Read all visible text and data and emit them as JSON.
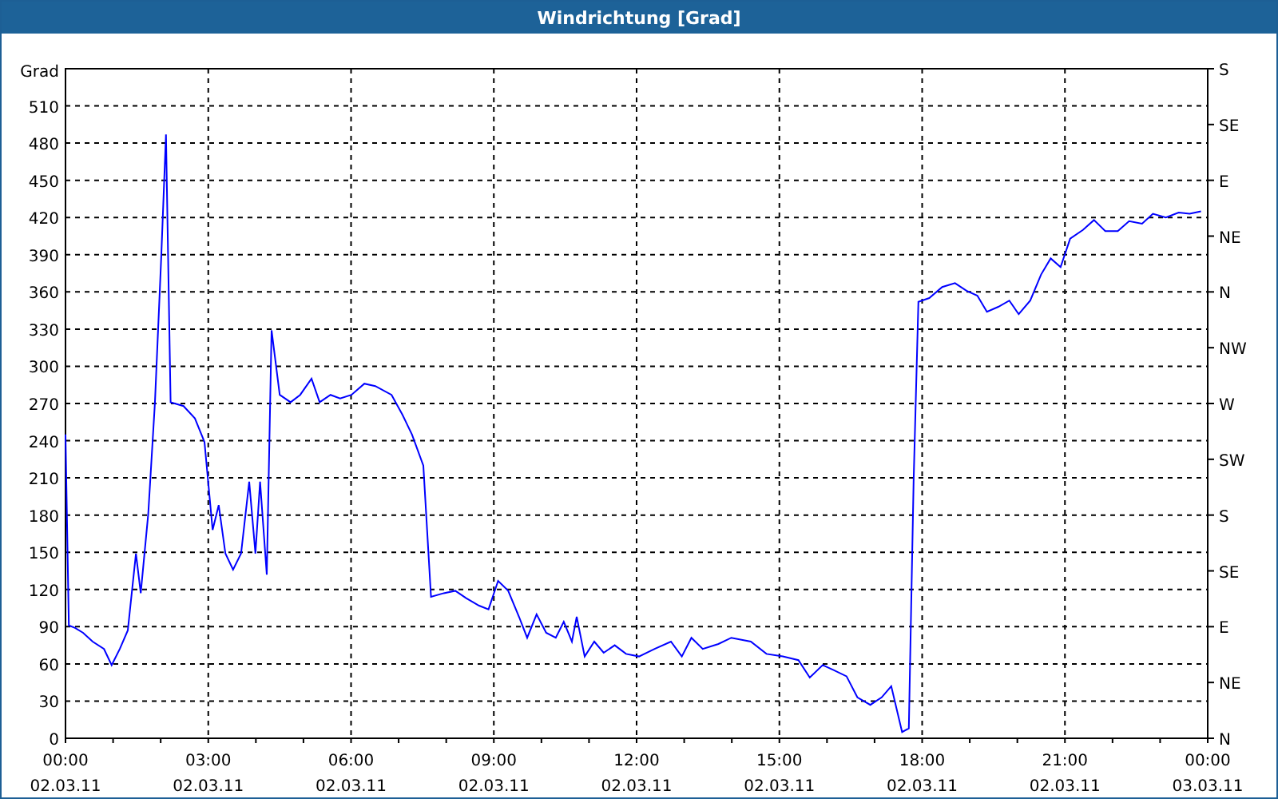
{
  "window": {
    "title": "Windrichtung [Grad]"
  },
  "chart": {
    "x_dates": [
      "02.03.11",
      "02.03.11",
      "02.03.11",
      "02.03.11",
      "02.03.11",
      "02.03.11",
      "02.03.11",
      "02.03.11",
      "03.03.11"
    ],
    "right_axis_labels": [
      "S",
      "SE",
      "E",
      "NE",
      "N",
      "NW",
      "W",
      "SW",
      "S",
      "SE",
      "E",
      "NE",
      "N"
    ],
    "chart_data": {
      "type": "line",
      "grid": true,
      "ylabel": "Grad",
      "xlim": [
        0,
        24
      ],
      "ylim": [
        0,
        540
      ],
      "xticks": [
        {
          "value": 0,
          "label": "00:00"
        },
        {
          "value": 3,
          "label": "03:00"
        },
        {
          "value": 6,
          "label": "06:00"
        },
        {
          "value": 9,
          "label": "09:00"
        },
        {
          "value": 12,
          "label": "12:00"
        },
        {
          "value": 15,
          "label": "15:00"
        },
        {
          "value": 18,
          "label": "18:00"
        },
        {
          "value": 21,
          "label": "21:00"
        },
        {
          "value": 24,
          "label": "00:00"
        }
      ],
      "yticks": [
        0,
        30,
        60,
        90,
        120,
        150,
        180,
        210,
        240,
        270,
        300,
        330,
        360,
        390,
        420,
        450,
        480,
        510
      ],
      "x": [
        0,
        0.07,
        0.2,
        0.37,
        0.57,
        0.81,
        0.97,
        1.14,
        1.31,
        1.48,
        1.58,
        1.74,
        1.88,
        2.01,
        2.11,
        2.21,
        2.48,
        2.72,
        2.92,
        3.09,
        3.22,
        3.36,
        3.52,
        3.69,
        3.86,
        3.99,
        4.09,
        4.23,
        4.33,
        4.5,
        4.73,
        4.93,
        5.17,
        5.34,
        5.57,
        5.77,
        6.01,
        6.28,
        6.51,
        6.85,
        7.08,
        7.28,
        7.52,
        7.68,
        7.95,
        8.19,
        8.42,
        8.69,
        8.89,
        9.09,
        9.3,
        9.53,
        9.7,
        9.9,
        10.1,
        10.3,
        10.47,
        10.64,
        10.74,
        10.91,
        11.11,
        11.31,
        11.54,
        11.78,
        12.05,
        12.38,
        12.72,
        12.95,
        13.15,
        13.39,
        13.72,
        13.99,
        14.4,
        14.73,
        15.07,
        15.4,
        15.64,
        15.91,
        16.14,
        16.41,
        16.64,
        16.91,
        17.15,
        17.35,
        17.58,
        17.72,
        17.82,
        17.92,
        18.15,
        18.42,
        18.69,
        18.93,
        19.16,
        19.36,
        19.6,
        19.83,
        20.03,
        20.27,
        20.5,
        20.7,
        20.91,
        21.11,
        21.38,
        21.61,
        21.85,
        22.11,
        22.35,
        22.62,
        22.85,
        23.12,
        23.39,
        23.62,
        23.86
      ],
      "series": [
        {
          "color": "#0000ff",
          "values": [
            245,
            91,
            89,
            85,
            78,
            72,
            59,
            72,
            87,
            149,
            117,
            181,
            271,
            387,
            487,
            271,
            268,
            258,
            239,
            168,
            188,
            149,
            136,
            149,
            207,
            149,
            207,
            132,
            329,
            277,
            271,
            277,
            290,
            271,
            277,
            274,
            277,
            286,
            284,
            277,
            261,
            245,
            220,
            114,
            117,
            119,
            113,
            107,
            104,
            127,
            119,
            98,
            81,
            100,
            85,
            81,
            94,
            78,
            98,
            66,
            78,
            69,
            75,
            68,
            66,
            72,
            78,
            66,
            81,
            72,
            76,
            81,
            78,
            68,
            66,
            63,
            49,
            59,
            55,
            50,
            33,
            27,
            33,
            42,
            5,
            8,
            207,
            352,
            355,
            364,
            367,
            361,
            357,
            344,
            348,
            353,
            342,
            353,
            374,
            387,
            380,
            403,
            410,
            418,
            409,
            409,
            417,
            415,
            423,
            420,
            424,
            423,
            425
          ]
        }
      ]
    }
  }
}
